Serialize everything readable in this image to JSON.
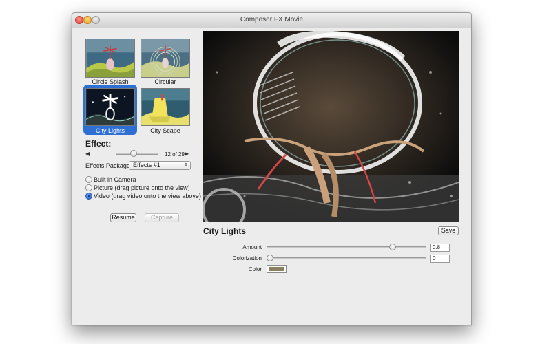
{
  "window": {
    "title": "Composer FX Movie"
  },
  "thumbnails": [
    {
      "label": "Circle Splash",
      "selected": false
    },
    {
      "label": "Circular",
      "selected": false
    },
    {
      "label": "City Lights",
      "selected": true
    },
    {
      "label": "City Scape",
      "selected": false
    }
  ],
  "effect": {
    "heading": "Effect:",
    "prev_arrow": "◀",
    "next_arrow": "▶",
    "counter": "12 of 29",
    "slider_fraction": 0.4
  },
  "package": {
    "label": "Effects Package",
    "selected": "Effects #1",
    "caret": "⌃⌄"
  },
  "source": {
    "options": [
      {
        "label": "Built in Camera",
        "checked": false
      },
      {
        "label": "Picture (drag picture onto the view)",
        "checked": false
      },
      {
        "label": "Video (drag video onto the view above)",
        "checked": true
      }
    ]
  },
  "buttons": {
    "resume": "Resume",
    "capture": "Capture",
    "save": "Save"
  },
  "current_effect": "City Lights",
  "params": {
    "amount": {
      "label": "Amount",
      "value": "0.8",
      "fraction": 0.8
    },
    "colorization": {
      "label": "Colorization",
      "value": "0",
      "fraction": 0.0
    },
    "color": {
      "label": "Color",
      "hex": "#8a7f5f"
    }
  },
  "colors": {
    "selection": "#2e6fd4"
  }
}
